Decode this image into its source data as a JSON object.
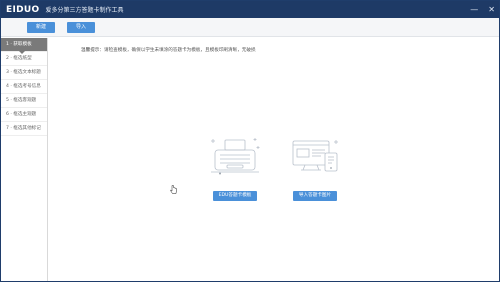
{
  "app": {
    "logo": "EIDUO",
    "title": "爱多分第三方答题卡制作工具"
  },
  "window_controls": [
    "minimize-icon",
    "close-icon"
  ],
  "toolbar": {
    "new_label": "新建",
    "import_label": "导入"
  },
  "steps": [
    {
      "label": "1 · 获取模板",
      "active": true
    },
    {
      "label": "2 · 框选纸型"
    },
    {
      "label": "3 · 框选文本标题"
    },
    {
      "label": "4 · 框选考号信息"
    },
    {
      "label": "5 · 框选客观题"
    },
    {
      "label": "6 · 框选主观题"
    },
    {
      "label": "7 · 框选其他标记"
    }
  ],
  "tip": {
    "label": "温馨提示：",
    "text": "请检查模板，确保以学生未填涂的答题卡为模板，且模板印刷清晰，无破损"
  },
  "cards": {
    "template_button": "EDU答题卡模板",
    "image_button": "导入答题卡图片"
  },
  "colors": {
    "titlebar": "#1e3a66",
    "accent": "#4a90d9",
    "active_step": "#7a7a7a"
  }
}
